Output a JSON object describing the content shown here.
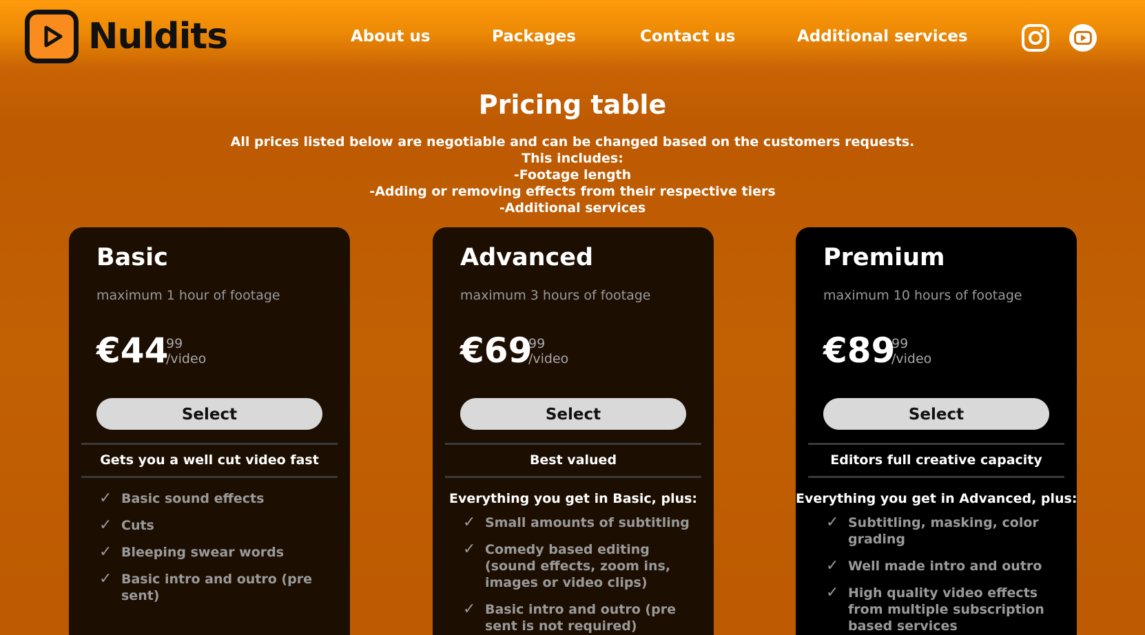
{
  "header": {
    "brand": "Nuldits",
    "nav": [
      {
        "label": "About us"
      },
      {
        "label": "Packages"
      },
      {
        "label": "Contact us"
      },
      {
        "label": "Additional services"
      }
    ],
    "social": [
      "instagram-icon",
      "youtube-icon"
    ]
  },
  "page": {
    "title": "Pricing table",
    "subtitle_lines": [
      "All prices listed below are negotiable and can be changed based on the customers requests.",
      "This includes:",
      "-Footage length",
      "-Adding or removing effects from their respective tiers",
      "-Additional services"
    ]
  },
  "plans": [
    {
      "name": "Basic",
      "description": "maximum 1 hour of footage",
      "price_main": "€44",
      "price_cents": "99",
      "price_unit": "/video",
      "button": "Select",
      "tagline": "Gets you a well cut video fast",
      "features_header": "",
      "features": [
        "Basic sound effects",
        "Cuts",
        "Bleeping swear words",
        "Basic intro and outro (pre sent)"
      ]
    },
    {
      "name": "Advanced",
      "description": "maximum 3 hours of footage",
      "price_main": "€69",
      "price_cents": "99",
      "price_unit": "/video",
      "button": "Select",
      "tagline": "Best valued",
      "features_header": "Everything you get in Basic, plus:",
      "features": [
        "Small amounts of subtitling",
        "Comedy based editing (sound effects, zoom ins, images or video clips)",
        "Basic intro and outro (pre sent is not required)"
      ]
    },
    {
      "name": "Premium",
      "description": "maximum 10 hours of footage",
      "price_main": "€89",
      "price_cents": "99",
      "price_unit": "/video",
      "button": "Select",
      "tagline": "Editors full creative capacity",
      "features_header": "Everything you get in Advanced, plus:",
      "features": [
        "Subtitling, masking, color grading",
        "Well made intro and outro",
        "High quality video effects from multiple subscription based services"
      ]
    }
  ],
  "colors": {
    "accent": "#f98c1d",
    "card_bg": "#1d0e02",
    "card_bg_premium": "#000000",
    "button_bg": "#d9d9d9"
  }
}
